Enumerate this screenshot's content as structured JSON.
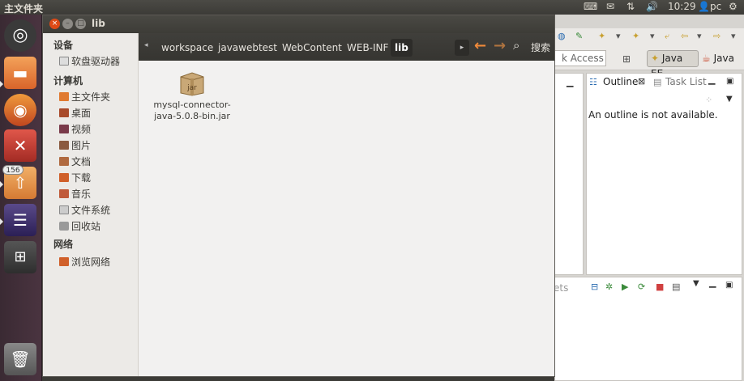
{
  "top_panel": {
    "app_title": "主文件夹",
    "time": "10:29",
    "user": "pc"
  },
  "launcher": {
    "badge_count": "156"
  },
  "nautilus": {
    "window_title": "lib",
    "breadcrumbs": [
      "workspace",
      "javawebtest",
      "WebContent",
      "WEB-INF",
      "lib"
    ],
    "search_label": "搜索",
    "sidebar": {
      "devices_heading": "设备",
      "devices": [
        "软盘驱动器"
      ],
      "computer_heading": "计算机",
      "computer": [
        "主文件夹",
        "桌面",
        "视频",
        "图片",
        "文档",
        "下载",
        "音乐",
        "文件系统",
        "回收站"
      ],
      "network_heading": "网络",
      "network": [
        "浏览网络"
      ]
    },
    "files": [
      {
        "name_line1": "mysql-connector-",
        "name_line2": "java-5.0.8-bin.jar",
        "icon_label": "jar"
      }
    ]
  },
  "eclipse": {
    "quick_access": "k Access",
    "perspective_ee": "Java EE",
    "perspective_java": "Java",
    "outline_tab": "Outline",
    "task_list_tab": "Task List",
    "outline_message": "An outline is not available.",
    "bottom_tab_fragment": "ets"
  }
}
